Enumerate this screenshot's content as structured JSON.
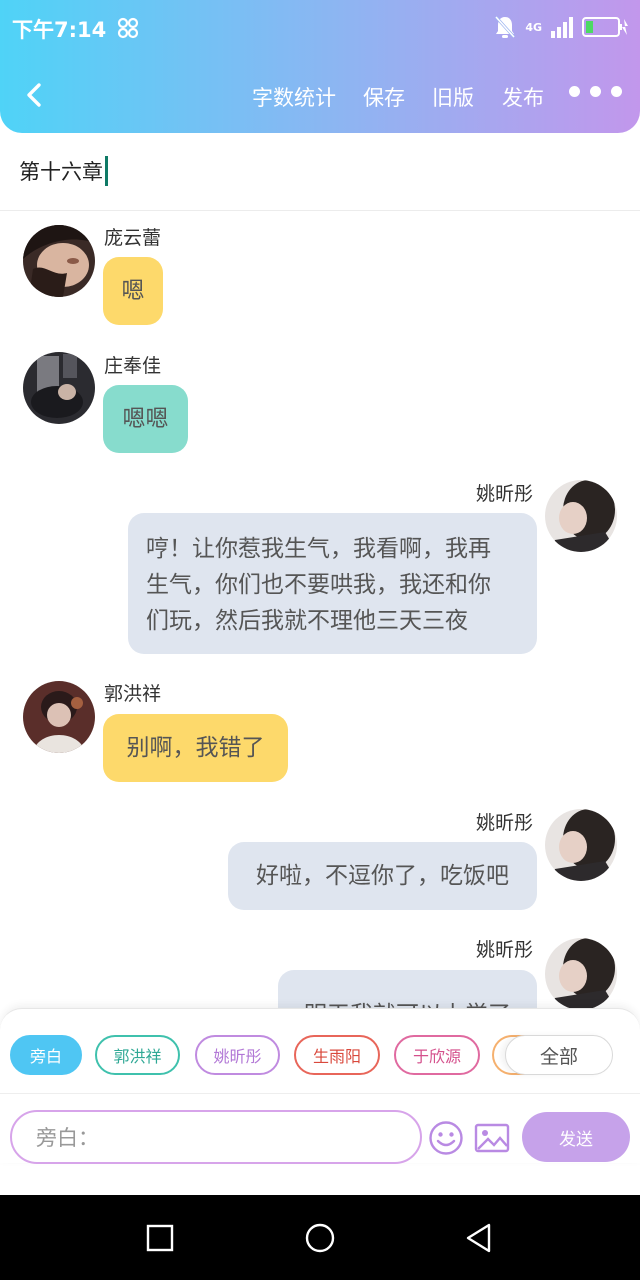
{
  "status_bar": {
    "time": "下午7:14",
    "network": "4G",
    "icons": [
      "link-icon",
      "bell-muted-icon",
      "signal-icon",
      "battery-icon"
    ]
  },
  "toolbar": {
    "back_icon": "chevron-left-icon",
    "word_count": "字数统计",
    "save": "保存",
    "old_version": "旧版",
    "publish": "发布",
    "more_icon": "more-dots-icon"
  },
  "chapter_title": "第十六章",
  "messages": [
    {
      "speaker": "庞云蕾",
      "text": "嗯",
      "side": "left",
      "color": "#fdd96b"
    },
    {
      "speaker": "庄奉佳",
      "text": "嗯嗯",
      "side": "left",
      "color": "#87dccd"
    },
    {
      "speaker": "姚昕彤",
      "lines": [
        "哼！让你惹我生气，我看啊，我再",
        "生气，你们也不要哄我，我还和你",
        "们玩，然后我就不理他三天三夜"
      ],
      "side": "right",
      "color": "#dfe5ef"
    },
    {
      "speaker": "郭洪祥",
      "text": "别啊，我错了",
      "side": "left",
      "color": "#fdd96b"
    },
    {
      "speaker": "姚昕彤",
      "text": "好啦，不逗你了，吃饭吧",
      "side": "right",
      "color": "#dfe5ef"
    },
    {
      "speaker": "姚昕彤",
      "text": "明天我就可以上学了",
      "side": "right",
      "color": "#dfe5ef"
    }
  ],
  "role_chips": [
    {
      "label": "旁白",
      "color": "#4fc6f3",
      "active": true
    },
    {
      "label": "郭洪祥",
      "color": "#3fc1ad",
      "active": false
    },
    {
      "label": "姚昕彤",
      "color": "#c08be0",
      "active": false
    },
    {
      "label": "生雨阳",
      "color": "#e8665a",
      "active": false
    },
    {
      "label": "于欣源",
      "color": "#e06aa0",
      "active": false
    }
  ],
  "all_chip": "全部",
  "input": {
    "placeholder": "旁白："
  },
  "send_label": "发送",
  "colors": {
    "header_start": "#4fd3f7",
    "header_end": "#c297ec",
    "send": "#c6a2ea"
  }
}
